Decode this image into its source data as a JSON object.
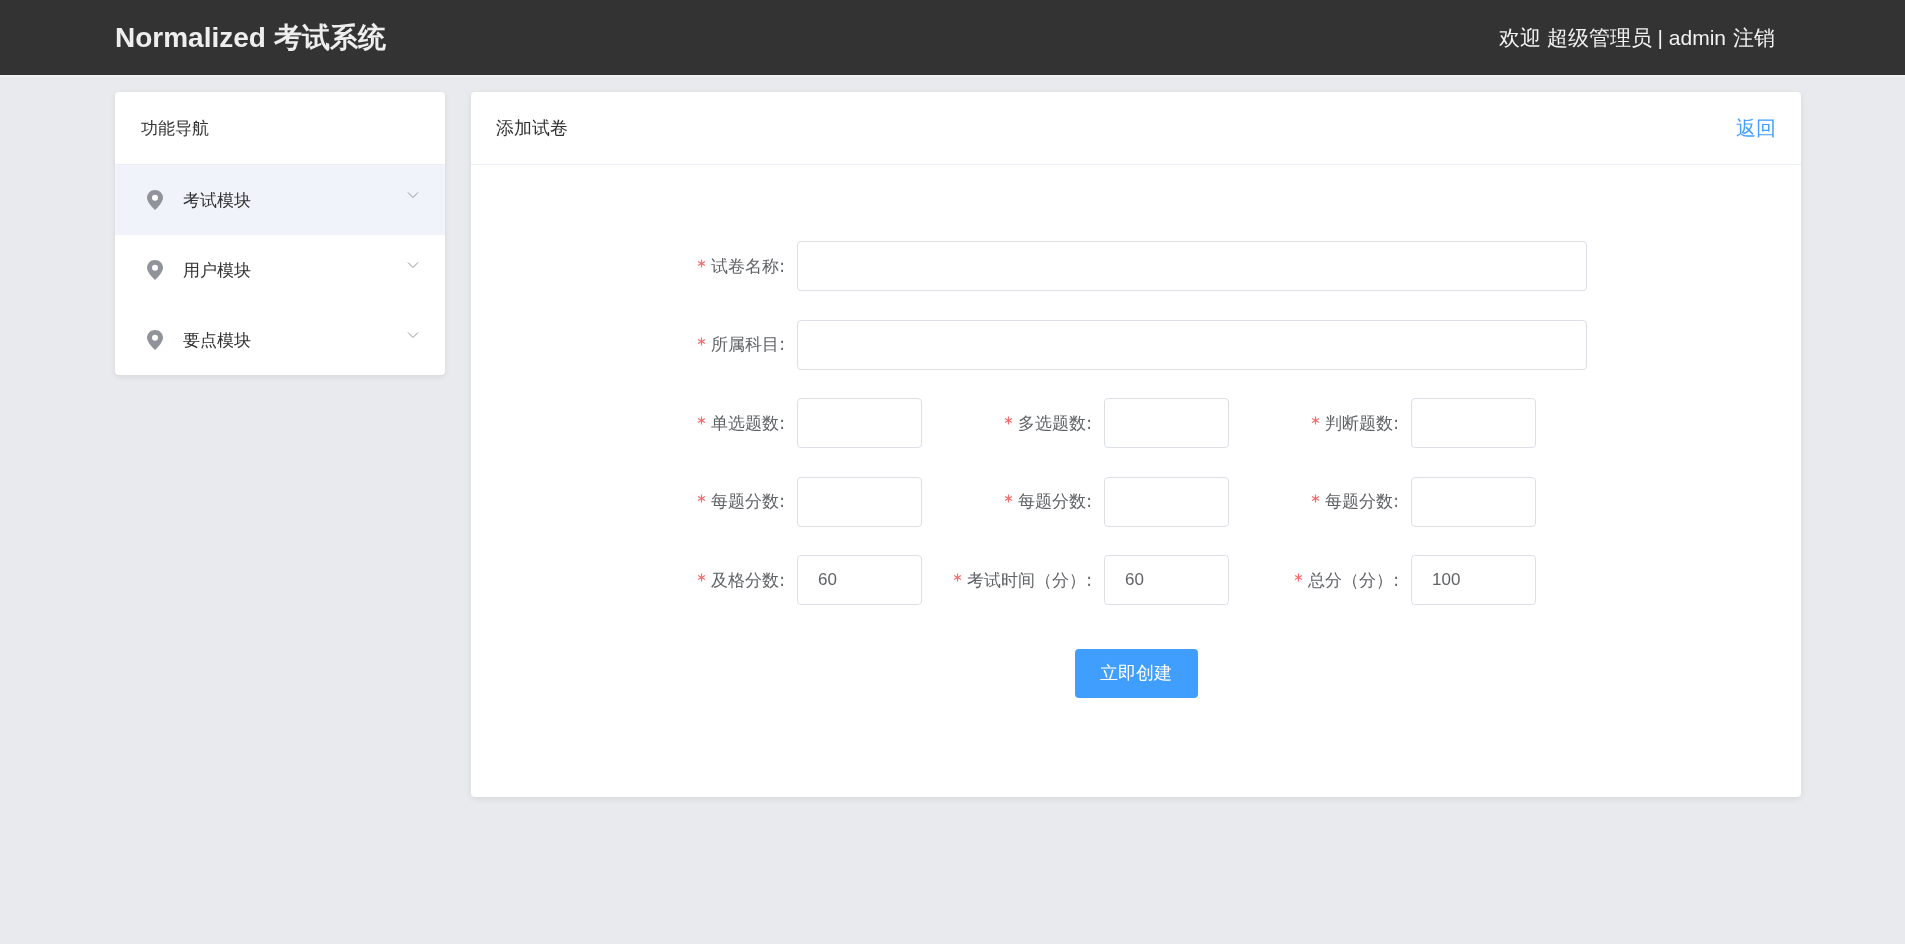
{
  "header": {
    "title": "Normalized 考试系统",
    "user_info": "欢迎 超级管理员 | admin",
    "logout": "注销"
  },
  "sidebar": {
    "title": "功能导航",
    "items": [
      {
        "label": "考试模块",
        "selected": true,
        "expanded": false
      },
      {
        "label": "用户模块",
        "selected": false,
        "expanded": false
      },
      {
        "label": "要点模块",
        "selected": false,
        "expanded": false
      }
    ]
  },
  "panel": {
    "title": "添加试卷",
    "back_link": "返回",
    "form": {
      "rows": [
        [
          {
            "label": "试卷名称:",
            "required": true
          }
        ],
        [
          {
            "label": "所属科目:",
            "required": true
          }
        ],
        [
          {
            "label": "单选题数:",
            "required": true
          },
          {
            "label": "多选题数:",
            "required": true
          },
          {
            "label": "判断题数:",
            "required": true
          }
        ],
        [
          {
            "label": "每题分数:",
            "required": true
          },
          {
            "label": "每题分数:",
            "required": true
          },
          {
            "label": "每题分数:",
            "required": true
          }
        ],
        [
          {
            "label": "及格分数:",
            "required": true,
            "value": "60"
          },
          {
            "label": "考试时间（分）:",
            "required": true,
            "value": "60"
          },
          {
            "label": "总分（分）:",
            "required": true,
            "value": "100"
          }
        ]
      ],
      "submit": "立即创建"
    }
  }
}
